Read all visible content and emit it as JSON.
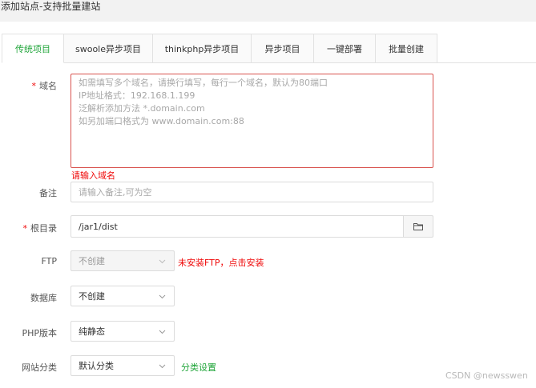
{
  "window": {
    "title": "添加站点-支持批量建站"
  },
  "tabs": [
    {
      "label": "传统项目",
      "active": true
    },
    {
      "label": "swoole异步项目"
    },
    {
      "label": "thinkphp异步项目"
    },
    {
      "label": "异步项目"
    },
    {
      "label": "一键部署"
    },
    {
      "label": "批量创建"
    }
  ],
  "form": {
    "domain": {
      "required_mark": "*",
      "label": "域名",
      "placeholder_lines": [
        "如需填写多个域名，请换行填写，每行一个域名，默认为80端口",
        "IP地址格式：192.168.1.199",
        "泛解析添加方法 *.domain.com",
        "如另加端口格式为 www.domain.com:88"
      ],
      "error": "请输入域名"
    },
    "remark": {
      "label": "备注",
      "placeholder": "请输入备注,可为空"
    },
    "root": {
      "required_mark": "*",
      "label": "根目录",
      "value": "/jar1/dist"
    },
    "ftp": {
      "label": "FTP",
      "value": "不创建",
      "warning": "未安装FTP，点击安装"
    },
    "database": {
      "label": "数据库",
      "value": "不创建"
    },
    "php_version": {
      "label": "PHP版本",
      "value": "纯静态"
    },
    "category": {
      "label": "网站分类",
      "value": "默认分类",
      "link": "分类设置"
    }
  },
  "watermark": "CSDN @newsswen",
  "colors": {
    "accent": "#20a53a",
    "error": "#ef0808",
    "border": "#dcdcdc",
    "placeholder": "#a8a8a8"
  }
}
